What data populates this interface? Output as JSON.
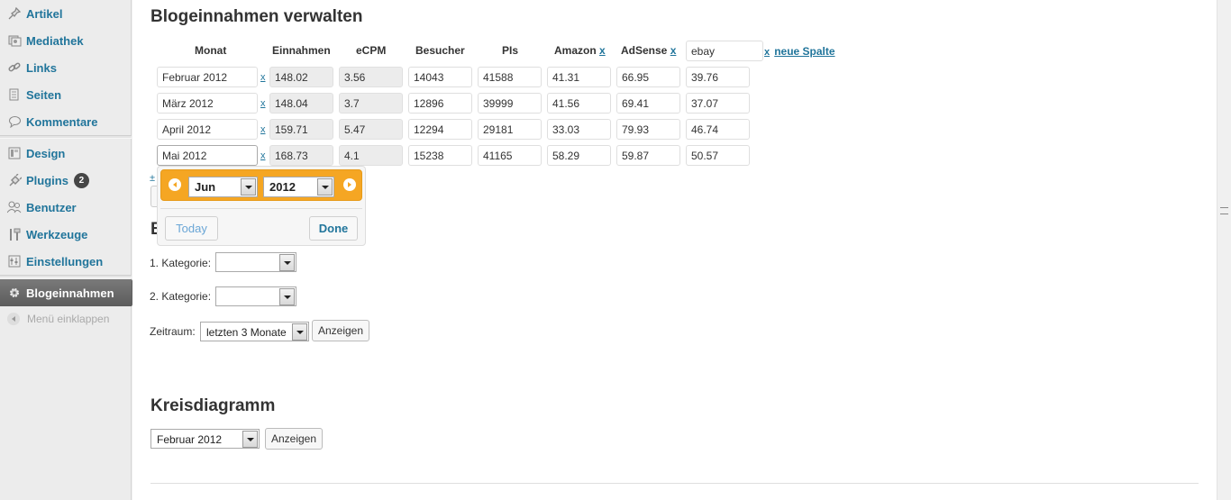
{
  "sidebar": {
    "items": [
      {
        "label": "Artikel",
        "icon": "pushpin-icon"
      },
      {
        "label": "Mediathek",
        "icon": "media-icon"
      },
      {
        "label": "Links",
        "icon": "link-icon"
      },
      {
        "label": "Seiten",
        "icon": "pages-icon"
      },
      {
        "label": "Kommentare",
        "icon": "comment-icon"
      },
      {
        "label": "Design",
        "icon": "appearance-icon"
      },
      {
        "label": "Plugins",
        "icon": "plug-icon",
        "badge": "2"
      },
      {
        "label": "Benutzer",
        "icon": "users-icon"
      },
      {
        "label": "Werkzeuge",
        "icon": "tools-icon"
      },
      {
        "label": "Einstellungen",
        "icon": "settings-icon"
      }
    ],
    "active": {
      "label": "Blogeinnahmen",
      "icon": "gear-icon"
    },
    "collapse_label": "Menü einklappen"
  },
  "page_title": "Blogeinnahmen verwalten",
  "table": {
    "headers": {
      "monat": "Monat",
      "einnahmen": "Einnahmen",
      "ecpm": "eCPM",
      "besucher": "Besucher",
      "pis": "PIs",
      "amazon": "Amazon",
      "adsense": "AdSense",
      "remove": "x",
      "new_col_value": "ebay",
      "new_col_link": "neue Spalte"
    },
    "rows": [
      {
        "monat": "Februar 2012",
        "einnahmen": "148.02",
        "ecpm": "3.56",
        "besucher": "14043",
        "pis": "41588",
        "amazon": "41.31",
        "adsense": "66.95",
        "ebay": "39.76"
      },
      {
        "monat": "März 2012",
        "einnahmen": "148.04",
        "ecpm": "3.7",
        "besucher": "12896",
        "pis": "39999",
        "amazon": "41.56",
        "adsense": "69.41",
        "ebay": "37.07"
      },
      {
        "monat": "April 2012",
        "einnahmen": "159.71",
        "ecpm": "5.47",
        "besucher": "12294",
        "pis": "29181",
        "amazon": "33.03",
        "adsense": "79.93",
        "ebay": "46.74"
      },
      {
        "monat": "Mai 2012",
        "einnahmen": "168.73",
        "ecpm": "4.1",
        "besucher": "15238",
        "pis": "41165",
        "amazon": "58.29",
        "adsense": "59.87",
        "ebay": "50.57"
      }
    ],
    "row_remove": "x",
    "add_partial": "±"
  },
  "datepicker": {
    "month": "Jun",
    "year": "2012",
    "today_label": "Today",
    "done_label": "Done"
  },
  "section_e": {
    "title_partial": "E",
    "kategorie1_label": "1. Kategorie:",
    "kategorie1_value": "",
    "kategorie2_label": "2. Kategorie:",
    "kategorie2_value": "",
    "zeitraum_label": "Zeitraum:",
    "zeitraum_value": "letzten 3 Monate",
    "show_button": "Anzeigen"
  },
  "pie": {
    "title": "Kreisdiagramm",
    "month_value": "Februar 2012",
    "show_button": "Anzeigen"
  },
  "colors": {
    "link": "#21759b",
    "datepicker_header": "#f5a623",
    "active_menu": "#5f5f5f"
  }
}
